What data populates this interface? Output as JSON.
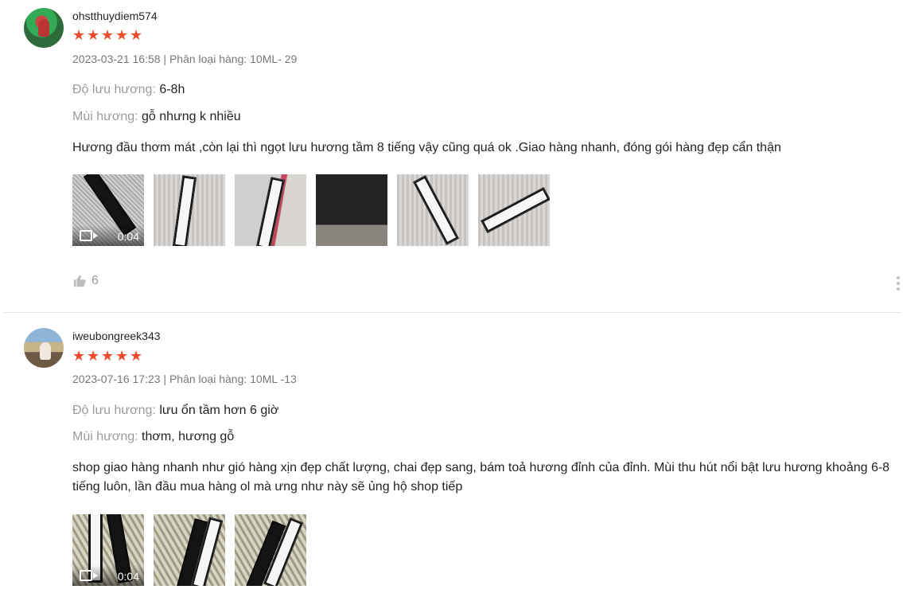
{
  "reviews": [
    {
      "username": "ohstthuydiem574",
      "rating": 5,
      "date_variant": "2023-03-21 16:58 | Phân loại hàng: 10ML- 29",
      "attrs": [
        {
          "label": "Độ lưu hương:",
          "value": "6-8h"
        },
        {
          "label": "Mùi hương:",
          "value": "gỗ nhưng k nhiều"
        }
      ],
      "content": "Hương đầu thơm mát ,còn lại thì ngọt lưu hương tầm 8 tiếng vậy cũng quá ok .Giao hàng nhanh, đóng gói hàng đẹp cẩn thận",
      "media": [
        {
          "type": "video",
          "duration": "0:04"
        },
        {
          "type": "image"
        },
        {
          "type": "image"
        },
        {
          "type": "image"
        },
        {
          "type": "image"
        },
        {
          "type": "image"
        }
      ],
      "likes": "6"
    },
    {
      "username": "iweubongreek343",
      "rating": 5,
      "date_variant": "2023-07-16 17:23 | Phân loại hàng: 10ML -13",
      "attrs": [
        {
          "label": "Độ lưu hương:",
          "value": "lưu ổn tầm hơn 6 giờ"
        },
        {
          "label": "Mùi hương:",
          "value": "thơm, hương gỗ"
        }
      ],
      "content": "shop giao hàng nhanh như gió hàng xịn đẹp chất lượng, chai đẹp sang, bám toả hương đỉnh của đỉnh. Mùi thu hút nổi bật lưu hương khoảng 6-8 tiếng luôn, lần đầu mua hàng ol mà ưng như này sẽ ủng hộ shop tiếp",
      "media": [
        {
          "type": "video",
          "duration": "0:04"
        },
        {
          "type": "image"
        },
        {
          "type": "image"
        }
      ]
    }
  ],
  "icons": {
    "star": "star-icon",
    "video": "video-camera-icon",
    "like": "thumbs-up-icon",
    "more": "more-vertical-icon"
  },
  "colors": {
    "star": "#ee4d2d",
    "muted": "#757575"
  }
}
